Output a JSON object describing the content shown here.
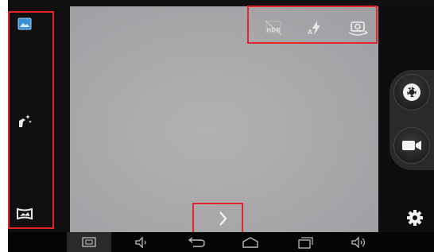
{
  "top_controls": {
    "hdr_label": "HDR",
    "flash_mode_label": "A"
  },
  "icons": {
    "gallery": "gallery-thumbnail-icon",
    "effects": "magic-wand-icon",
    "panorama": "panorama-icon",
    "hdr": "hdr-off-icon",
    "flash": "flash-auto-icon",
    "switch_camera": "switch-camera-icon",
    "shutter": "shutter-aperture-icon",
    "video": "video-camera-icon",
    "settings": "gear-icon",
    "expand": "chevron-right-icon",
    "nav_screenshot": "screenshot-icon",
    "nav_volume_down": "volume-down-icon",
    "nav_back": "back-arrow-icon",
    "nav_home": "home-icon",
    "nav_recents": "recent-apps-icon",
    "nav_volume_up": "volume-up-icon"
  },
  "colors": {
    "highlight": "#e4262c",
    "viewfinder": "#a9a9ab",
    "bar_background": "#111111",
    "gallery_accent": "#3a8fd6"
  }
}
